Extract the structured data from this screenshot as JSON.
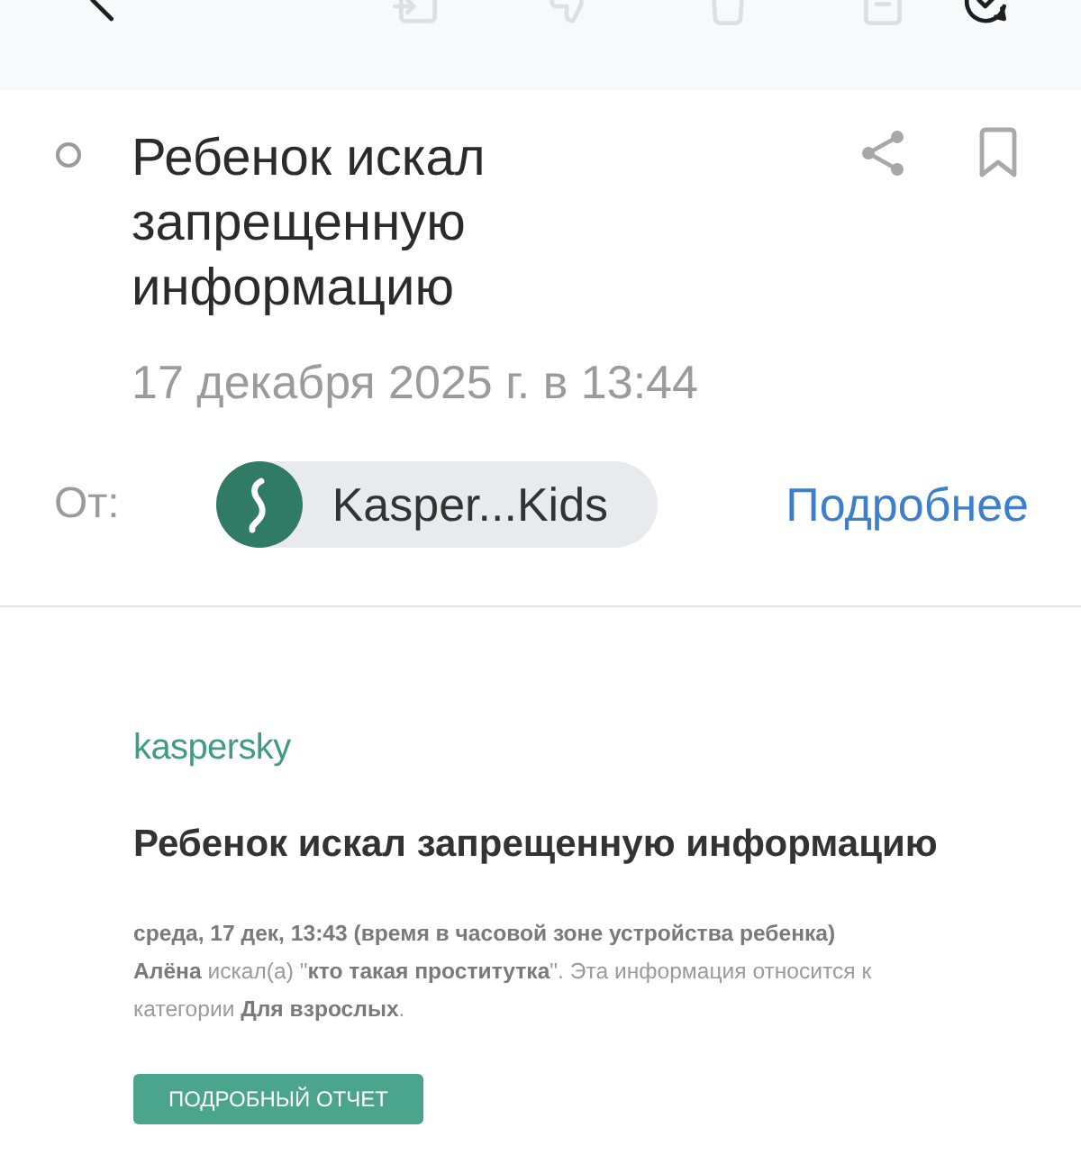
{
  "toolbar": {
    "items": [
      {
        "kind": "back",
        "disabled": false
      },
      {
        "kind": "move",
        "disabled": true
      },
      {
        "kind": "spam",
        "disabled": true
      },
      {
        "kind": "delete",
        "disabled": true
      },
      {
        "kind": "archive",
        "disabled": true
      },
      {
        "kind": "done",
        "disabled": false
      }
    ]
  },
  "message": {
    "read": true,
    "title": "Ребенок искал запрещенную информацию",
    "date": "17 декабря 2025 г. в 13:44",
    "from_label": "От:",
    "sender": "Kasper...Kids",
    "details_link": "Подробнее"
  },
  "email_body": {
    "logo": "kaspersky",
    "heading": "Ребенок искал запрещенную информацию",
    "timestamp": "среда, 17 дек, 13:43 (время в часовой зоне устройства ребенка)",
    "text": "**Алёна** искал(а) \"**кто такая проститутка**\". Эта информация относится к категории **Для взрослых**.",
    "button": "ПОДРОБНЫЙ ОТЧЕТ"
  }
}
